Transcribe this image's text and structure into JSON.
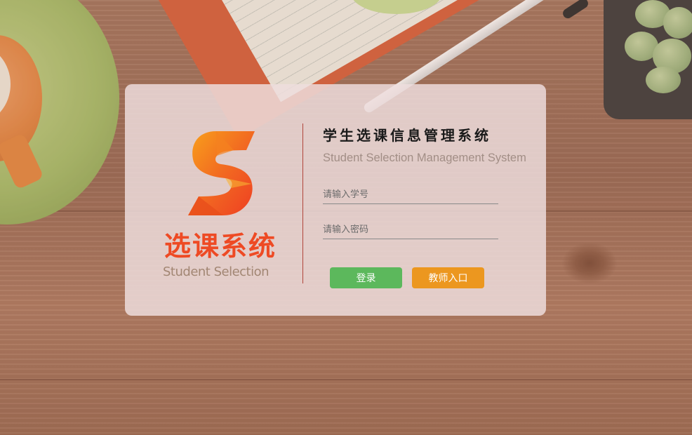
{
  "logo": {
    "text_cn": "选课系统",
    "text_en": "Student Selection"
  },
  "header": {
    "title_cn": "学生选课信息管理系统",
    "title_en": "Student Selection Management System"
  },
  "form": {
    "student_id_placeholder": "请输入学号",
    "password_placeholder": "请输入密码",
    "login_label": "登录",
    "teacher_entry_label": "教师入口"
  },
  "colors": {
    "accent_red": "#ee4a24",
    "login_button": "#5cb85c",
    "teacher_button": "#ec971f"
  }
}
